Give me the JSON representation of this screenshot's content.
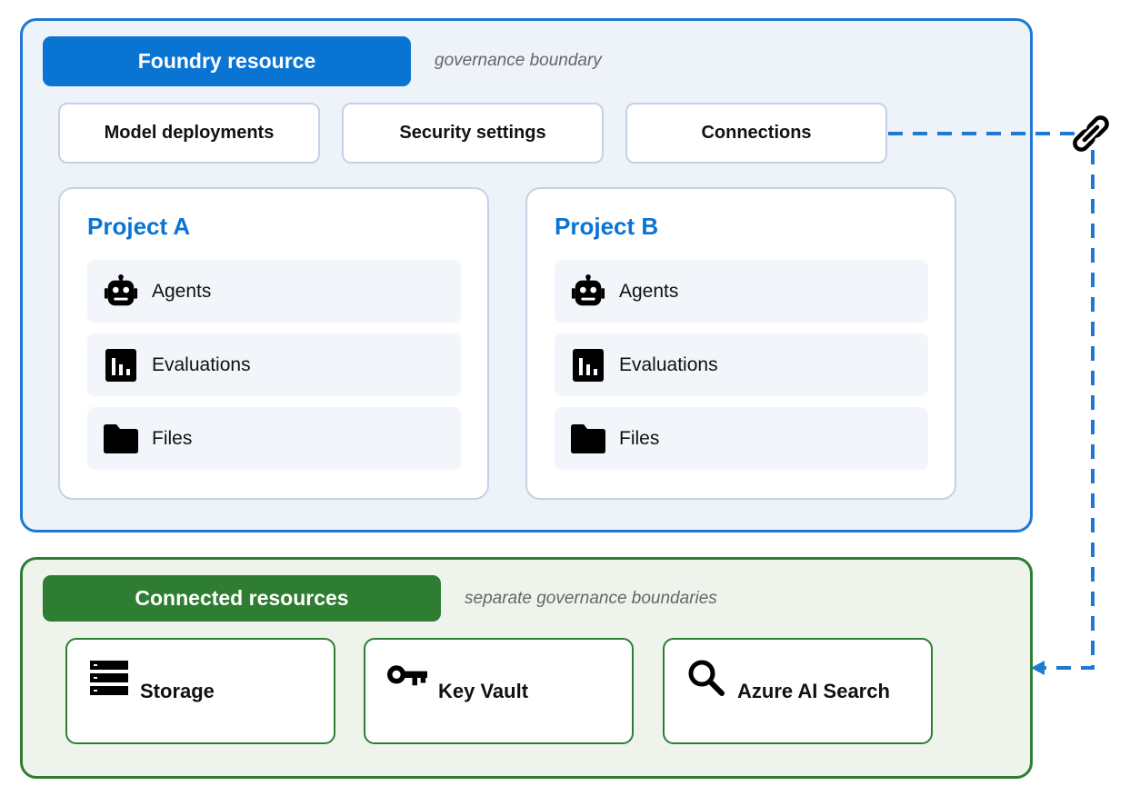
{
  "foundry": {
    "title": "Foundry resource",
    "note": "governance boundary",
    "shared": [
      "Model deployments",
      "Security settings",
      "Connections"
    ],
    "projects": [
      {
        "title": "Project A",
        "items": [
          "Agents",
          "Evaluations",
          "Files"
        ]
      },
      {
        "title": "Project B",
        "items": [
          "Agents",
          "Evaluations",
          "Files"
        ]
      }
    ]
  },
  "connected": {
    "title": "Connected resources",
    "note": "separate governance boundaries",
    "resources": [
      "Storage",
      "Key Vault",
      "Azure AI Search"
    ]
  },
  "icons": {
    "agents": "robot-icon",
    "evaluations": "bar-chart-icon",
    "files": "folder-icon",
    "storage": "storage-icon",
    "key_vault": "key-icon",
    "search": "search-icon",
    "link": "link-icon"
  },
  "colors": {
    "foundry_accent": "#0a74d2",
    "connected_accent": "#2e7d32",
    "connector": "#1f78d1"
  }
}
